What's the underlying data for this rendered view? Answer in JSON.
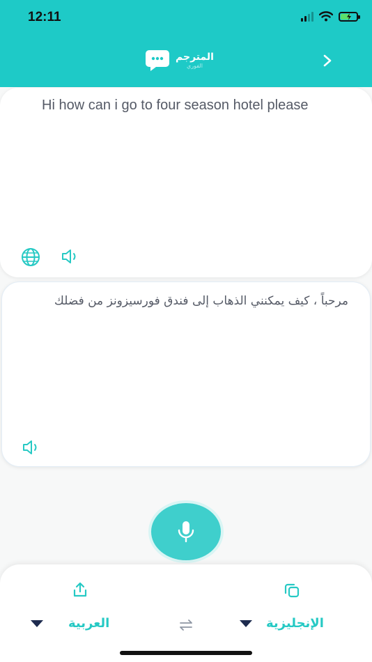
{
  "status": {
    "time": "12:11"
  },
  "header": {
    "app_title": "المترجم",
    "app_subtitle": "الفوري",
    "back_icon": "chevron-right-icon"
  },
  "source": {
    "text": "Hi how can i go to four season hotel please",
    "icons": [
      "globe-icon",
      "speaker-icon"
    ]
  },
  "target": {
    "text": "مرحباً ، كيف يمكنني الذهاب إلى فندق فورسيزونز من فضلك",
    "icons": [
      "speaker-icon"
    ]
  },
  "controls": {
    "mic_icon": "microphone-icon",
    "share_icon": "share-icon",
    "copy_icon": "copy-icon",
    "swap_icon": "swap-icon",
    "from_language": "الإنجليزية",
    "to_language": "العربية"
  },
  "colors": {
    "accent": "#1ecac7",
    "text": "#555a66",
    "dark": "#1d2b4f"
  }
}
